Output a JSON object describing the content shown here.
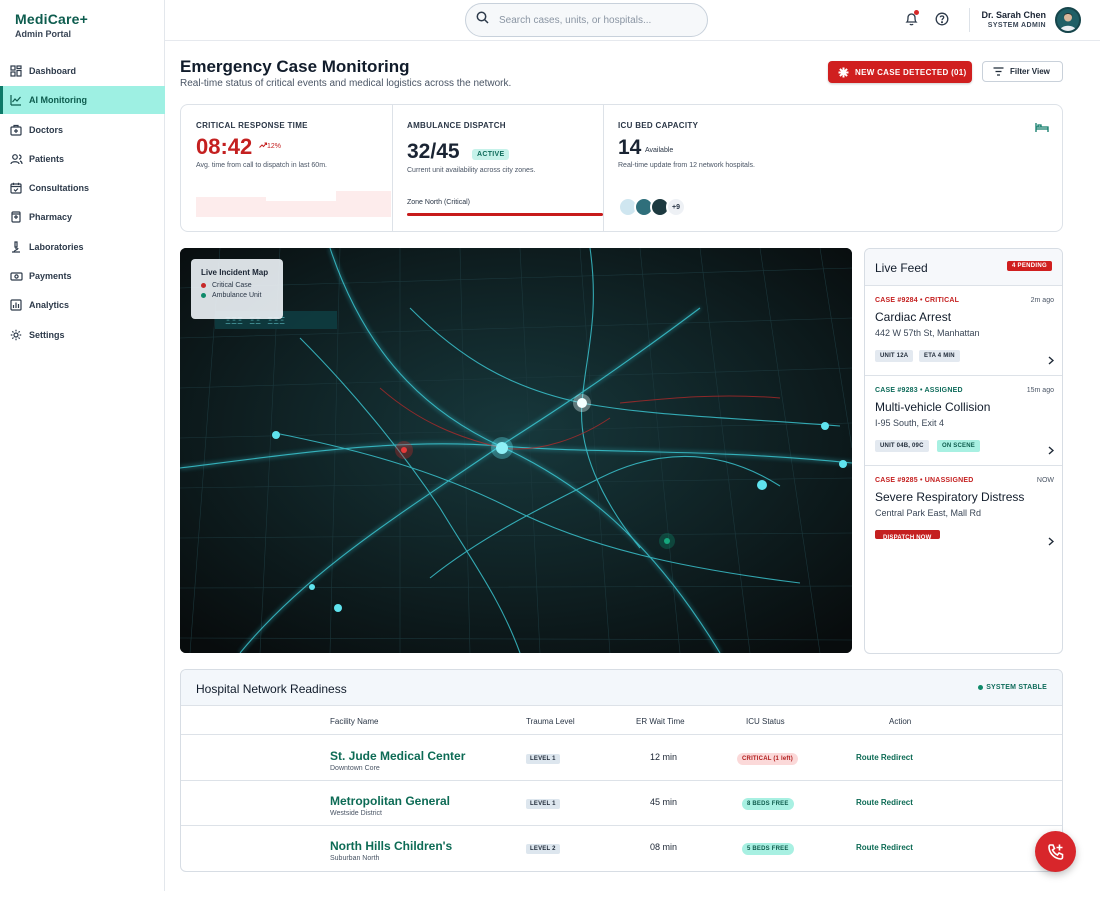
{
  "brand": {
    "name": "MediCare+",
    "subtitle": "Admin Portal"
  },
  "nav": [
    {
      "label": "Dashboard",
      "icon": "grid-icon"
    },
    {
      "label": "AI Monitoring",
      "icon": "chart-line-icon",
      "active": true
    },
    {
      "label": "Doctors",
      "icon": "medical-bag-icon"
    },
    {
      "label": "Patients",
      "icon": "users-icon"
    },
    {
      "label": "Consultations",
      "icon": "calendar-check-icon"
    },
    {
      "label": "Pharmacy",
      "icon": "pill-icon"
    },
    {
      "label": "Laboratories",
      "icon": "microscope-icon"
    },
    {
      "label": "Payments",
      "icon": "money-icon"
    },
    {
      "label": "Analytics",
      "icon": "bar-chart-icon"
    },
    {
      "label": "Settings",
      "icon": "gear-icon"
    }
  ],
  "topbar": {
    "search_placeholder": "Search cases, units, or hospitals...",
    "user_name": "Dr. Sarah Chen",
    "user_role": "SYSTEM ADMIN"
  },
  "header": {
    "title": "Emergency Case Monitoring",
    "subtitle": "Real-time status of critical events and medical logistics across the network.",
    "new_case_label": "NEW CASE DETECTED (01)",
    "filter_label": "Filter View"
  },
  "stats": {
    "response": {
      "label": "CRITICAL RESPONSE TIME",
      "value": "08:42",
      "trend": "12%",
      "desc": "Avg. time from call to dispatch in last 60m."
    },
    "ambulance": {
      "label": "AMBULANCE DISPATCH",
      "value": "32/45",
      "badge": "ACTIVE",
      "desc": "Current unit availability across city zones.",
      "zone": "Zone North (Critical)"
    },
    "icu": {
      "label": "ICU BED CAPACITY",
      "value": "14",
      "unit": "Available",
      "desc": "Real-time update from 12 network hospitals.",
      "more": "+9"
    }
  },
  "map": {
    "legend_title": "Live Incident Map",
    "legend_critical": "Critical Case",
    "legend_ambulance": "Ambulance Unit",
    "colors": {
      "critical": "#c62828",
      "ambulance": "#0e8a6a"
    }
  },
  "feed": {
    "title": "Live Feed",
    "pending": "4 PENDING",
    "cases": [
      {
        "tag": "CASE #9284 • CRITICAL",
        "time": "2m ago",
        "title": "Cardiac Arrest",
        "address": "442 W 57th St, Manhattan",
        "chip1": "UNIT 12A",
        "chip2": "ETA 4 MIN"
      },
      {
        "tag": "CASE #9283 • ASSIGNED",
        "time": "15m ago",
        "title": "Multi-vehicle Collision",
        "address": "I-95 South, Exit 4",
        "chip1": "UNIT 04B, 09C",
        "chip2": "ON SCENE"
      },
      {
        "tag": "CASE #9285 • UNASSIGNED",
        "time": "NOW",
        "title": "Severe Respiratory Distress",
        "address": "Central Park East, Mall Rd",
        "chip1": "DISPATCH NOW"
      }
    ]
  },
  "network": {
    "title": "Hospital Network Readiness",
    "status": "SYSTEM STABLE",
    "columns": [
      "Facility Name",
      "Trauma Level",
      "ER Wait Time",
      "ICU Status",
      "Action"
    ],
    "rows": [
      {
        "name": "St. Jude Medical Center",
        "location": "Downtown Core",
        "level": "LEVEL 1",
        "wait": "12 min",
        "icu": "CRITICAL (1 left)",
        "icu_state": "critical",
        "action": "Route Redirect"
      },
      {
        "name": "Metropolitan General",
        "location": "Westside District",
        "level": "LEVEL 1",
        "wait": "45 min",
        "icu": "8 BEDS FREE",
        "icu_state": "ok",
        "action": "Route Redirect"
      },
      {
        "name": "North Hills Children's",
        "location": "Suburban North",
        "level": "LEVEL 2",
        "wait": "08 min",
        "icu": "5 BEDS FREE",
        "icu_state": "ok",
        "action": "Route Redirect"
      }
    ]
  }
}
